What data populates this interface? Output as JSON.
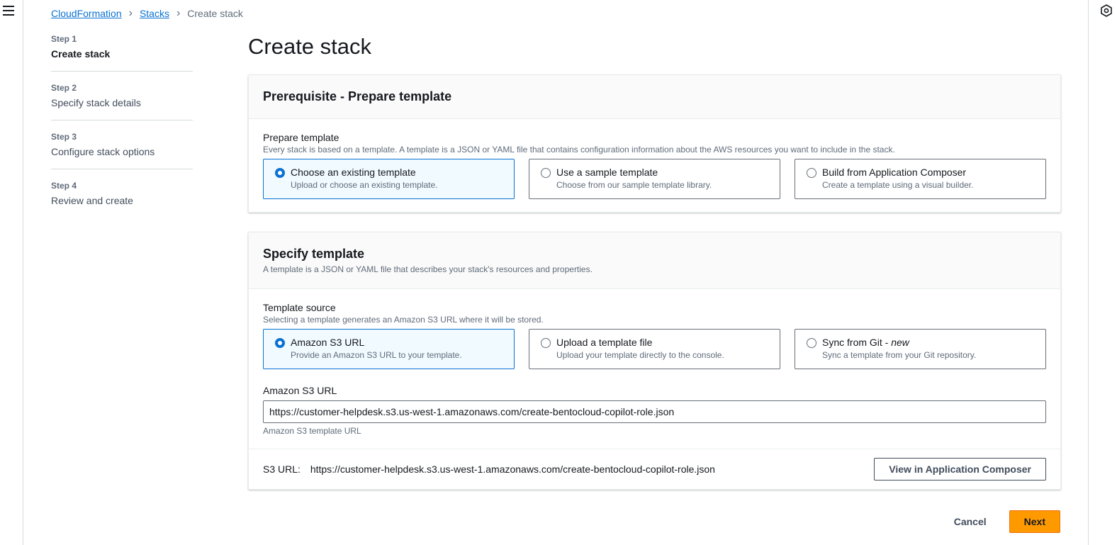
{
  "breadcrumb": {
    "root": "CloudFormation",
    "stacks": "Stacks",
    "current": "Create stack"
  },
  "steps": [
    {
      "num": "Step 1",
      "title": "Create stack"
    },
    {
      "num": "Step 2",
      "title": "Specify stack details"
    },
    {
      "num": "Step 3",
      "title": "Configure stack options"
    },
    {
      "num": "Step 4",
      "title": "Review and create"
    }
  ],
  "page_title": "Create stack",
  "prerequisite": {
    "heading": "Prerequisite - Prepare template",
    "label": "Prepare template",
    "description": "Every stack is based on a template. A template is a JSON or YAML file that contains configuration information about the AWS resources you want to include in the stack.",
    "options": [
      {
        "title": "Choose an existing template",
        "desc": "Upload or choose an existing template.",
        "selected": true
      },
      {
        "title": "Use a sample template",
        "desc": "Choose from our sample template library.",
        "selected": false
      },
      {
        "title": "Build from Application Composer",
        "desc": "Create a template using a visual builder.",
        "selected": false
      }
    ]
  },
  "specify": {
    "heading": "Specify template",
    "subheading": "A template is a JSON or YAML file that describes your stack's resources and properties.",
    "source_label": "Template source",
    "source_desc": "Selecting a template generates an Amazon S3 URL where it will be stored.",
    "options": [
      {
        "title": "Amazon S3 URL",
        "desc": "Provide an Amazon S3 URL to your template.",
        "selected": true
      },
      {
        "title": "Upload a template file",
        "desc": "Upload your template directly to the console.",
        "selected": false
      },
      {
        "title": "Sync from Git - ",
        "title_em": "new",
        "desc": "Sync a template from your Git repository.",
        "selected": false
      }
    ],
    "url_label": "Amazon S3 URL",
    "url_value": "https://customer-helpdesk.s3.us-west-1.amazonaws.com/create-bentocloud-copilot-role.json",
    "url_constraint": "Amazon S3 template URL",
    "s3_label": "S3 URL:",
    "s3_value": "https://customer-helpdesk.s3.us-west-1.amazonaws.com/create-bentocloud-copilot-role.json",
    "view_button": "View in Application Composer"
  },
  "actions": {
    "cancel": "Cancel",
    "next": "Next"
  }
}
